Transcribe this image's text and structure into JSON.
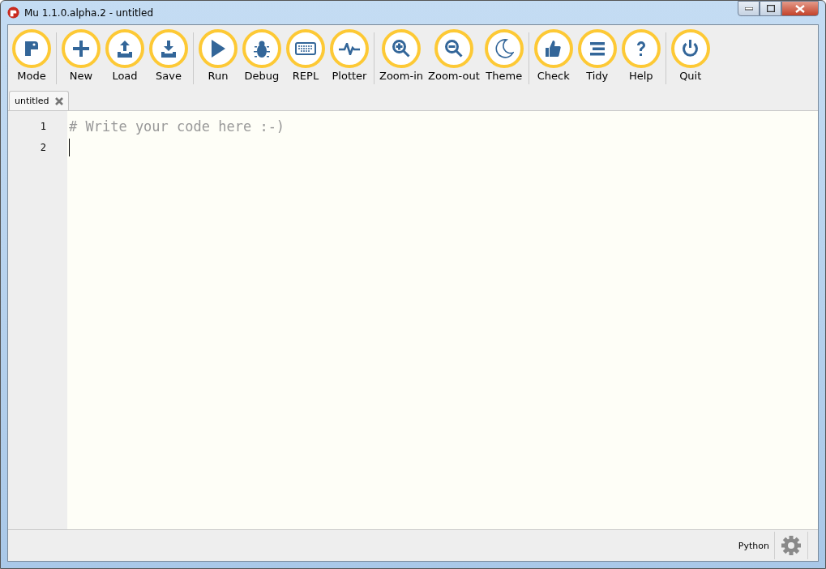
{
  "window": {
    "title": "Mu 1.1.0.alpha.2 - untitled"
  },
  "toolbar": {
    "groups": [
      [
        {
          "label": "Mode"
        }
      ],
      [
        {
          "label": "New"
        },
        {
          "label": "Load"
        },
        {
          "label": "Save"
        }
      ],
      [
        {
          "label": "Run"
        },
        {
          "label": "Debug"
        },
        {
          "label": "REPL"
        },
        {
          "label": "Plotter"
        }
      ],
      [
        {
          "label": "Zoom-in"
        },
        {
          "label": "Zoom-out"
        },
        {
          "label": "Theme"
        }
      ],
      [
        {
          "label": "Check"
        },
        {
          "label": "Tidy"
        },
        {
          "label": "Help"
        }
      ],
      [
        {
          "label": "Quit"
        }
      ]
    ]
  },
  "tabs": [
    {
      "label": "untitled",
      "selected": true
    }
  ],
  "editor": {
    "lines": [
      {
        "number": "1",
        "text": "# Write your code here :-)",
        "cursor": false
      },
      {
        "number": "2",
        "cursor": true
      }
    ]
  },
  "status_bar": {
    "mode": "Python"
  }
}
